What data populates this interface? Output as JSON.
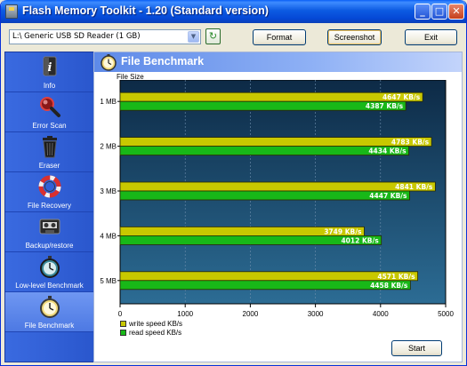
{
  "window": {
    "title": "Flash Memory Toolkit - 1.20 (Standard version)"
  },
  "toolbar": {
    "drive": "L:\\ Generic USB SD Reader (1 GB)",
    "format_label": "Format",
    "screenshot_label": "Screenshot",
    "exit_label": "Exit"
  },
  "sidebar": {
    "items": [
      {
        "label": "Info",
        "icon": "info-icon"
      },
      {
        "label": "Error Scan",
        "icon": "magnifier-icon"
      },
      {
        "label": "Eraser",
        "icon": "trash-bin-icon"
      },
      {
        "label": "File Recovery",
        "icon": "life-ring-icon"
      },
      {
        "label": "Backup/restore",
        "icon": "tape-cassette-icon"
      },
      {
        "label": "Low-level Benchmark",
        "icon": "stopwatch-icon"
      },
      {
        "label": "File Benchmark",
        "icon": "stopwatch-icon",
        "active": true
      }
    ]
  },
  "panel": {
    "title": "File Benchmark",
    "start_label": "Start"
  },
  "chart_data": {
    "type": "bar",
    "orientation": "horizontal",
    "title": "File Size",
    "categories": [
      "1 MB",
      "2 MB",
      "3 MB",
      "4 MB",
      "5 MB"
    ],
    "series": [
      {
        "name": "write speed KB/s",
        "color": "#c8c800",
        "values": [
          4647,
          4783,
          4841,
          3749,
          4571
        ],
        "labels": [
          "4647 KB/s",
          "4783 KB/s",
          "4841 KB/s",
          "3749 KB/s",
          "4571 KB/s"
        ]
      },
      {
        "name": "read speed KB/s",
        "color": "#18b818",
        "values": [
          4387,
          4434,
          4447,
          4012,
          4458
        ],
        "labels": [
          "4387 KB/s",
          "4434 KB/s",
          "4447 KB/s",
          "4012 KB/s",
          "4458 KB/s"
        ]
      }
    ],
    "xlim": [
      0,
      5000
    ],
    "xticks": [
      "0",
      "1000",
      "2000",
      "3000",
      "4000",
      "5000"
    ],
    "grid": true,
    "legend": "bottom-left"
  }
}
